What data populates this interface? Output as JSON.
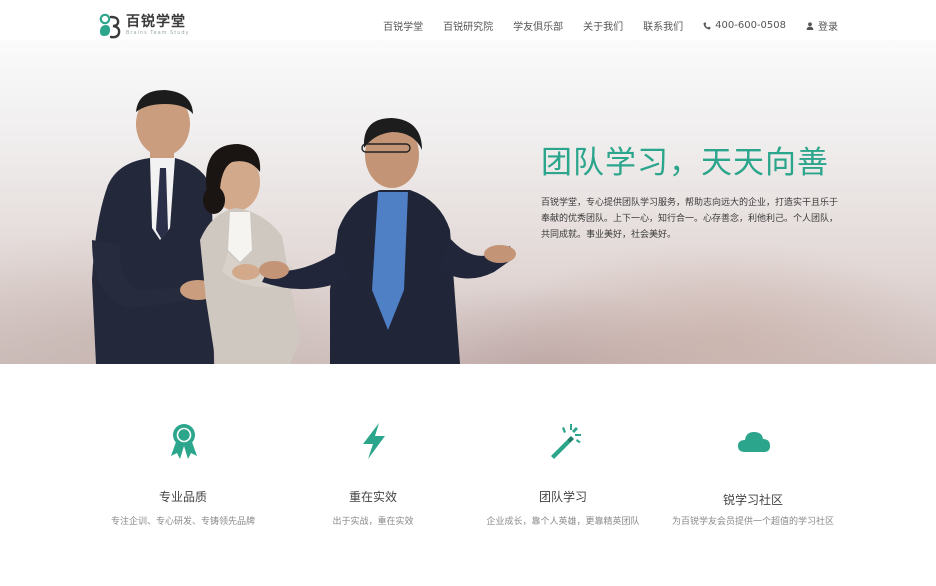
{
  "brand": {
    "name": "百锐学堂",
    "tagline": "Brains Team Study",
    "accent": "#2ba58b"
  },
  "nav": {
    "items": [
      "百锐学堂",
      "百锐研究院",
      "学友俱乐部",
      "关于我们",
      "联系我们"
    ],
    "phone": "400-600-0508",
    "phone_icon": "phone-icon",
    "login": "登录",
    "login_icon": "user-icon"
  },
  "hero": {
    "title": "团队学习，天天向善",
    "description": "百锐学堂，专心提供团队学习服务，帮助志向远大的企业，打造实干且乐于奉献的优秀团队。上下一心，知行合一。心存善念，利他利己。个人团队，共同成就。事业美好，社会美好。"
  },
  "features": [
    {
      "icon": "award-ribbon-icon",
      "title": "专业品质",
      "desc": "专注企训、专心研发、专铸领先品牌"
    },
    {
      "icon": "lightning-bolt-icon",
      "title": "重在实效",
      "desc": "出于实战，重在实效"
    },
    {
      "icon": "magic-wand-icon",
      "title": "团队学习",
      "desc": "企业成长，靠个人英雄，更靠精英团队"
    },
    {
      "icon": "cloud-icon",
      "title": "锐学习社区",
      "desc": "为百锐学友会员提供一个超值的学习社区"
    }
  ]
}
